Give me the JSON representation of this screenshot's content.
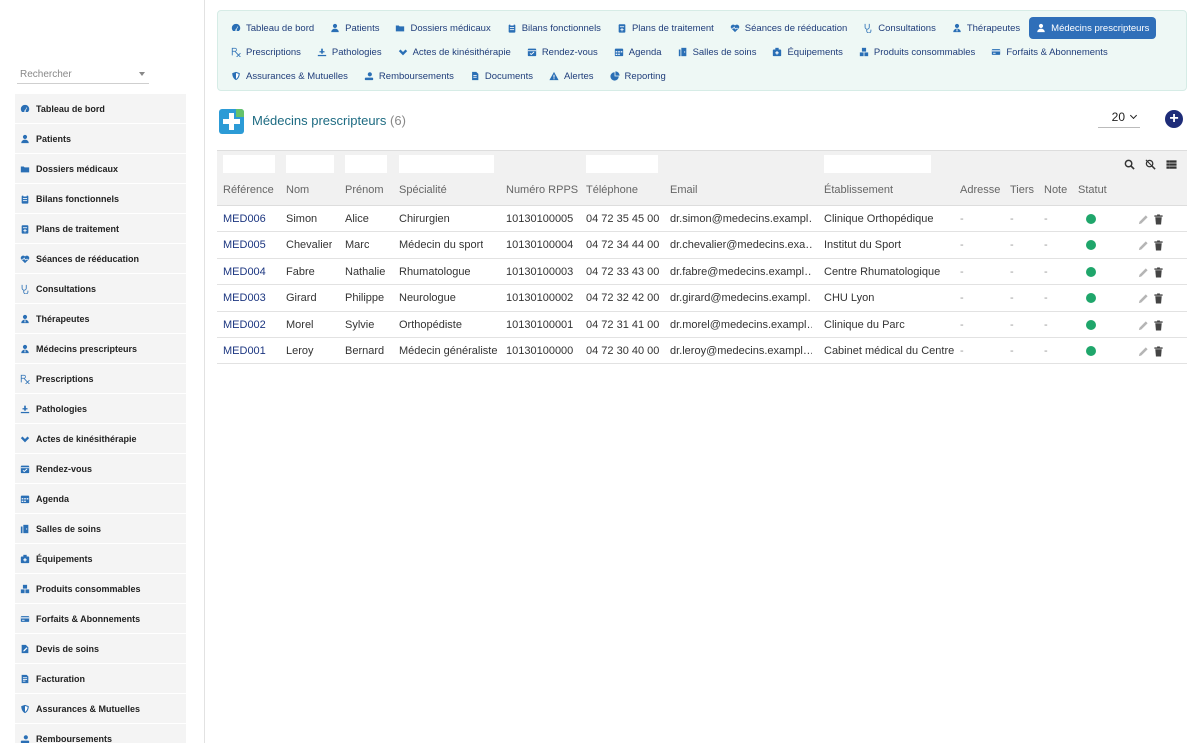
{
  "sidebar": {
    "search_placeholder": "Rechercher",
    "items": [
      {
        "label": "Tableau de bord",
        "icon": "dashboard-icon"
      },
      {
        "label": "Patients",
        "icon": "user-icon"
      },
      {
        "label": "Dossiers médicaux",
        "icon": "folder-icon"
      },
      {
        "label": "Bilans fonctionnels",
        "icon": "clipboard-icon"
      },
      {
        "label": "Plans de traitement",
        "icon": "plan-icon"
      },
      {
        "label": "Séances de rééducation",
        "icon": "heartbeat-icon"
      },
      {
        "label": "Consultations",
        "icon": "stethoscope-icon"
      },
      {
        "label": "Thérapeutes",
        "icon": "user-md-icon"
      },
      {
        "label": "Médecins prescripteurs",
        "icon": "user-md-icon"
      },
      {
        "label": "Prescriptions",
        "icon": "prescription-icon"
      },
      {
        "label": "Pathologies",
        "icon": "disease-icon"
      },
      {
        "label": "Actes de kinésithérapie",
        "icon": "hands-icon"
      },
      {
        "label": "Rendez-vous",
        "icon": "calendar-check-icon"
      },
      {
        "label": "Agenda",
        "icon": "calendar-icon"
      },
      {
        "label": "Salles de soins",
        "icon": "door-icon"
      },
      {
        "label": "Équipements",
        "icon": "medkit-icon"
      },
      {
        "label": "Produits consommables",
        "icon": "boxes-icon"
      },
      {
        "label": "Forfaits & Abonnements",
        "icon": "card-icon"
      },
      {
        "label": "Devis de soins",
        "icon": "file-edit-icon"
      },
      {
        "label": "Facturation",
        "icon": "invoice-icon"
      },
      {
        "label": "Assurances & Mutuelles",
        "icon": "shield-icon"
      },
      {
        "label": "Remboursements",
        "icon": "hand-money-icon"
      }
    ]
  },
  "topnav": {
    "rows": [
      [
        {
          "label": "Tableau de bord",
          "icon": "dashboard-icon"
        },
        {
          "label": "Patients",
          "icon": "user-icon"
        },
        {
          "label": "Dossiers médicaux",
          "icon": "folder-icon"
        },
        {
          "label": "Bilans fonctionnels",
          "icon": "clipboard-icon"
        },
        {
          "label": "Plans de traitement",
          "icon": "plan-icon"
        },
        {
          "label": "Séances de rééducation",
          "icon": "heartbeat-icon"
        },
        {
          "label": "Consultations",
          "icon": "stethoscope-icon"
        },
        {
          "label": "Thérapeutes",
          "icon": "user-md-icon"
        },
        {
          "label": "Médecins prescripteurs",
          "icon": "user-md-icon",
          "active": true
        }
      ],
      [
        {
          "label": "Prescriptions",
          "icon": "prescription-icon"
        },
        {
          "label": "Pathologies",
          "icon": "disease-icon"
        },
        {
          "label": "Actes de kinésithérapie",
          "icon": "hands-icon"
        },
        {
          "label": "Rendez-vous",
          "icon": "calendar-check-icon"
        },
        {
          "label": "Agenda",
          "icon": "calendar-icon"
        },
        {
          "label": "Salles de soins",
          "icon": "door-icon"
        },
        {
          "label": "Équipements",
          "icon": "medkit-icon"
        },
        {
          "label": "Produits consommables",
          "icon": "boxes-icon"
        },
        {
          "label": "Forfaits & Abonnements",
          "icon": "card-icon"
        }
      ],
      [
        {
          "label": "Assurances & Mutuelles",
          "icon": "shield-icon"
        },
        {
          "label": "Remboursements",
          "icon": "hand-money-icon"
        },
        {
          "label": "Documents",
          "icon": "file-icon"
        },
        {
          "label": "Alertes",
          "icon": "warning-icon"
        },
        {
          "label": "Reporting",
          "icon": "chart-pie-icon"
        }
      ]
    ]
  },
  "page": {
    "title": "Médecins prescripteurs",
    "count": "(6)",
    "per_page": "20",
    "add_label": "+"
  },
  "table": {
    "columns": [
      "Référence",
      "Nom",
      "Prénom",
      "Spécialité",
      "Numéro RPPS",
      "Téléphone",
      "Email",
      "Établissement",
      "Adresse",
      "Tiers",
      "Note",
      "Statut"
    ],
    "rows": [
      {
        "ref": "MED006",
        "nom": "Simon",
        "prenom": "Alice",
        "specialite": "Chirurgien",
        "rpps": "10130100005",
        "tel": "04 72 35 45 00",
        "email": "dr.simon@medecins.exampl…",
        "etab": "Clinique Orthopédique",
        "adresse": "-",
        "tiers": "-",
        "note": "-"
      },
      {
        "ref": "MED005",
        "nom": "Chevalier",
        "prenom": "Marc",
        "specialite": "Médecin du sport",
        "rpps": "10130100004",
        "tel": "04 72 34 44 00",
        "email": "dr.chevalier@medecins.exa…",
        "etab": "Institut du Sport",
        "adresse": "-",
        "tiers": "-",
        "note": "-"
      },
      {
        "ref": "MED004",
        "nom": "Fabre",
        "prenom": "Nathalie",
        "specialite": "Rhumatologue",
        "rpps": "10130100003",
        "tel": "04 72 33 43 00",
        "email": "dr.fabre@medecins.exampl…",
        "etab": "Centre Rhumatologique",
        "adresse": "-",
        "tiers": "-",
        "note": "-"
      },
      {
        "ref": "MED003",
        "nom": "Girard",
        "prenom": "Philippe",
        "specialite": "Neurologue",
        "rpps": "10130100002",
        "tel": "04 72 32 42 00",
        "email": "dr.girard@medecins.exampl…",
        "etab": "CHU Lyon",
        "adresse": "-",
        "tiers": "-",
        "note": "-"
      },
      {
        "ref": "MED002",
        "nom": "Morel",
        "prenom": "Sylvie",
        "specialite": "Orthopédiste",
        "rpps": "10130100001",
        "tel": "04 72 31 41 00",
        "email": "dr.morel@medecins.exampl…",
        "etab": "Clinique du Parc",
        "adresse": "-",
        "tiers": "-",
        "note": "-"
      },
      {
        "ref": "MED001",
        "nom": "Leroy",
        "prenom": "Bernard",
        "specialite": "Médecin généraliste",
        "rpps": "10130100000",
        "tel": "04 72 30 40 00",
        "email": "dr.leroy@medecins.exampl…",
        "etab": "Cabinet médical du Centre",
        "adresse": "-",
        "tiers": "-",
        "note": "-"
      }
    ]
  },
  "colors": {
    "accent": "#2f6fb9",
    "status_active": "#1fa66b",
    "link": "#1c3680"
  }
}
